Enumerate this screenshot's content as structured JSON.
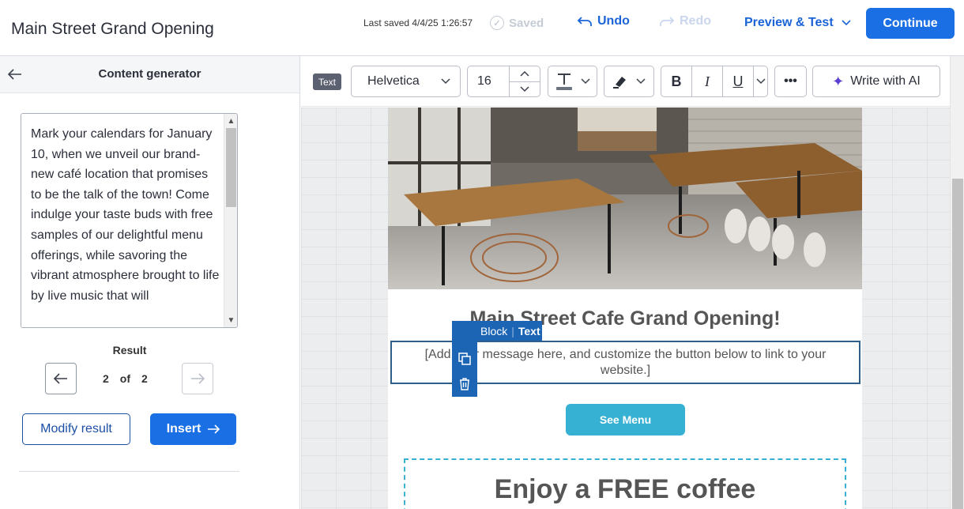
{
  "header": {
    "title": "Main Street Grand Opening",
    "last_saved": "Last saved 4/4/25 1:26:57",
    "saved_label": "Saved",
    "undo_label": "Undo",
    "redo_label": "Redo",
    "preview_label": "Preview & Test",
    "continue_label": "Continue"
  },
  "sidebar": {
    "title": "Content generator",
    "generated_text": "Mark your calendars for January 10, when we unveil our brand-new café location that promises to be the talk of the town! Come indulge your taste buds with free samples of our delightful menu offerings, while savoring the vibrant atmosphere brought to life by live music that will",
    "result_label": "Result",
    "result_current": "2",
    "result_of": "of",
    "result_total": "2",
    "modify_label": "Modify result",
    "insert_label": "Insert"
  },
  "toolbar": {
    "tag": "Text",
    "font": "Helvetica",
    "font_size": "16",
    "more": "•••",
    "ai_label": "Write with AI",
    "bold": "B",
    "italic": "I",
    "underline": "U"
  },
  "email": {
    "title": "Main Street Cafe Grand Opening!",
    "placeholder_text": "[Add your message here, and customize the button below to link to your website.]",
    "block_label": "Block",
    "block_type": "Text",
    "button_label": "See Menu",
    "promo_text": "Enjoy a FREE coffee"
  },
  "colors": {
    "accent": "#1b6fe4",
    "link": "#1b64d8",
    "block_blue": "#1b65b4",
    "button_teal": "#36b0d3"
  },
  "icons": [
    "back-arrow-icon",
    "check-circle-icon",
    "undo-icon",
    "redo-icon",
    "chevron-down-icon",
    "arrow-left-icon",
    "arrow-right-icon",
    "text-color-icon",
    "highlighter-icon",
    "sparkle-icon",
    "move-icon",
    "duplicate-icon",
    "trash-icon"
  ]
}
